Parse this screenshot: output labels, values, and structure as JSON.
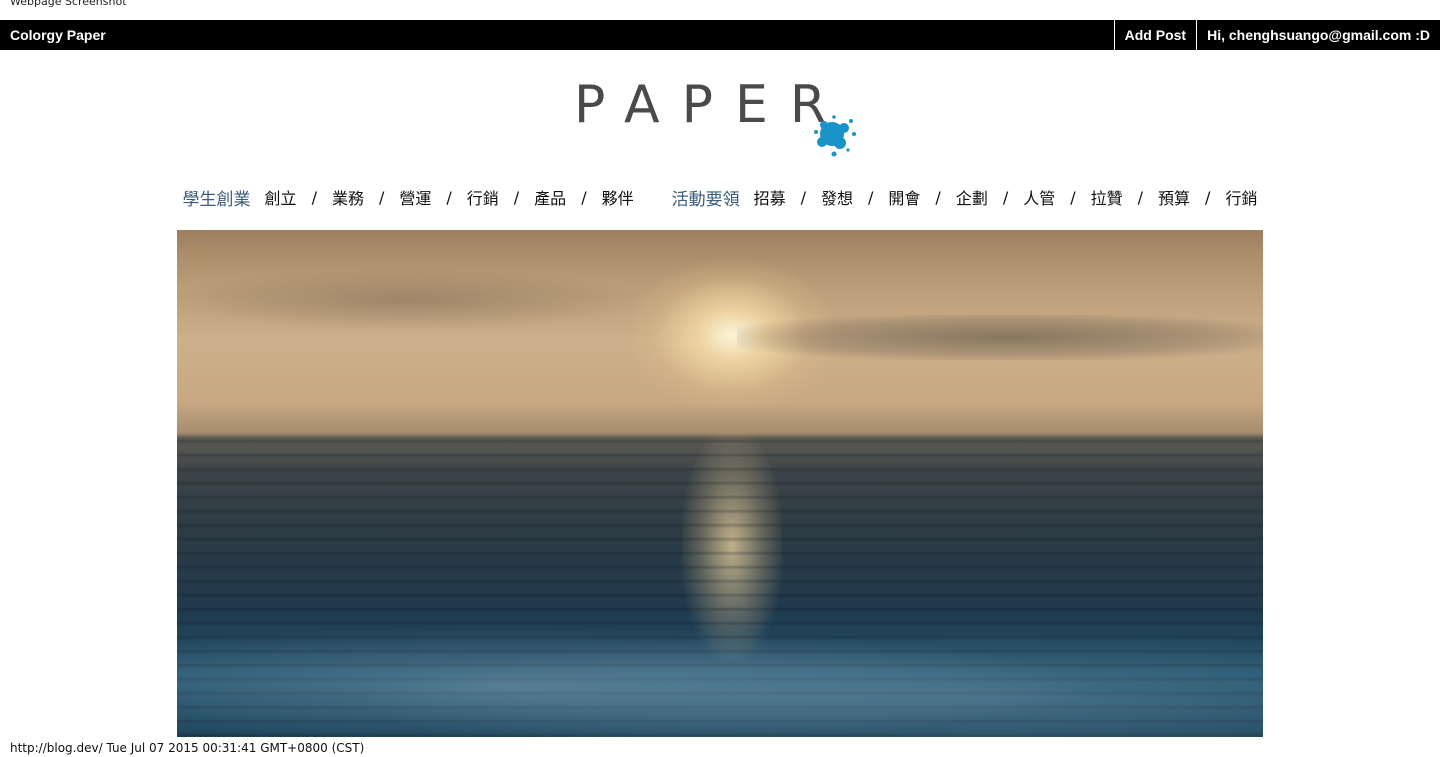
{
  "screenshot_label": "Webpage Screenshot",
  "topbar": {
    "brand": "Colorgy Paper",
    "add_post": "Add Post",
    "user_greeting": "Hi, chenghsuango@gmail.com :D"
  },
  "logo": {
    "text": "PAPER",
    "splash_color": "#1a93c8"
  },
  "nav": {
    "groups": [
      {
        "category": "學生創業",
        "items": [
          "創立",
          "業務",
          "營運",
          "行銷",
          "產品",
          "夥伴"
        ]
      },
      {
        "category": "活動要領",
        "items": [
          "招募",
          "發想",
          "開會",
          "企劃",
          "人管",
          "拉贊",
          "預算",
          "行銷"
        ]
      }
    ],
    "separator": "/"
  },
  "hero": {
    "subject": "ocean-sunset"
  },
  "status_line": "http://blog.dev/ Tue Jul 07 2015 00:31:41 GMT+0800 (CST)",
  "colors": {
    "topbar_bg": "#000000",
    "category_accent": "#3b5c7c",
    "logo_text": "#4a4a4a"
  }
}
